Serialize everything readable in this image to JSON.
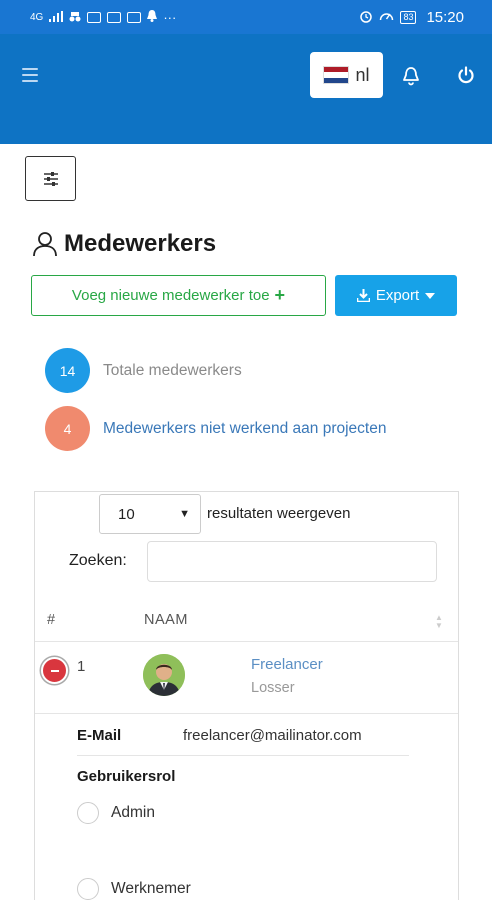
{
  "statusbar": {
    "network": "4G",
    "time": "15:20",
    "battery": "83"
  },
  "header": {
    "language": "nl",
    "flag_colors": [
      "#ae1c28",
      "#ffffff",
      "#21468b"
    ]
  },
  "page": {
    "title": "Medewerkers",
    "add_button_label": "Voeg nieuwe medewerker toe",
    "add_button_icon": "+",
    "export_button_label": "Export"
  },
  "stats": [
    {
      "value": "14",
      "label": "Totale medewerkers",
      "color": "#1e9be6"
    },
    {
      "value": "4",
      "label": "Medewerkers niet werkend aan projecten",
      "color": "#f08a6e"
    }
  ],
  "table": {
    "page_length": "10",
    "page_length_label": "resultaten weergeven",
    "search_label": "Zoeken:",
    "search_value": "",
    "columns": [
      "#",
      "NAAM"
    ],
    "rows": [
      {
        "number": "1",
        "first_name": "Freelancer",
        "last_name": "Losser",
        "email_label": "E-Mail",
        "email": "freelancer@mailinator.com",
        "role_label": "Gebruikersrol",
        "roles": [
          "Admin",
          "Werknemer"
        ]
      }
    ]
  },
  "colors": {
    "primary": "#0e73c4",
    "success": "#28a745",
    "info": "#17a2e8",
    "danger": "#d9363e"
  }
}
